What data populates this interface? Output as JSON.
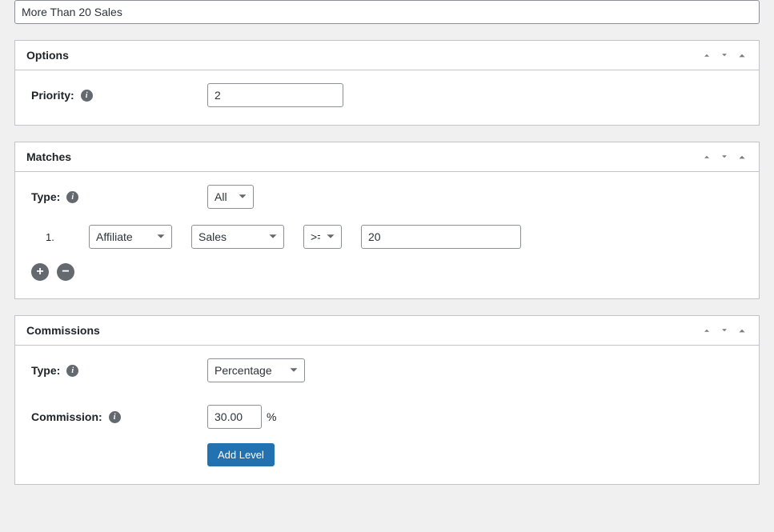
{
  "title": "More Than 20 Sales",
  "panels": {
    "options": {
      "heading": "Options",
      "priority_label": "Priority:",
      "priority_value": "2"
    },
    "matches": {
      "heading": "Matches",
      "type_label": "Type:",
      "type_value": "All",
      "rules": [
        {
          "num": "1.",
          "subject": "Affiliate",
          "metric": "Sales",
          "operator": ">=",
          "value": "20"
        }
      ]
    },
    "commissions": {
      "heading": "Commissions",
      "type_label": "Type:",
      "type_value": "Percentage",
      "commission_label": "Commission:",
      "commission_value": "30.00",
      "commission_suffix": "%",
      "add_level_label": "Add Level"
    }
  }
}
